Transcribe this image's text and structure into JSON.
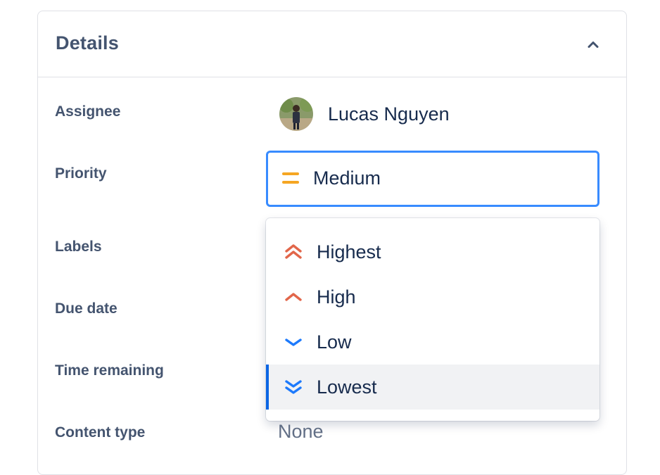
{
  "panel": {
    "title": "Details"
  },
  "fields": {
    "assignee_label": "Assignee",
    "priority_label": "Priority",
    "labels_label": "Labels",
    "due_date_label": "Due date",
    "time_remaining_label": "Time remaining",
    "content_type_label": "Content type"
  },
  "assignee": {
    "name": "Lucas Nguyen"
  },
  "priority": {
    "selected": "Medium",
    "selected_icon": "priority-medium-icon",
    "selected_color": "#f5a623"
  },
  "dropdown": {
    "options": [
      {
        "label": "Highest",
        "icon": "priority-highest-icon",
        "color": "#e2664a"
      },
      {
        "label": "High",
        "icon": "priority-high-icon",
        "color": "#e2664a"
      },
      {
        "label": "Low",
        "icon": "priority-low-icon",
        "color": "#1d7afc"
      },
      {
        "label": "Lowest",
        "icon": "priority-lowest-icon",
        "color": "#1d7afc"
      }
    ],
    "highlighted": "Lowest"
  },
  "content_type": {
    "value": "None"
  },
  "colors": {
    "focus_border": "#388bff",
    "highlight_bar": "#0c66e4",
    "label_text": "#44546f"
  }
}
